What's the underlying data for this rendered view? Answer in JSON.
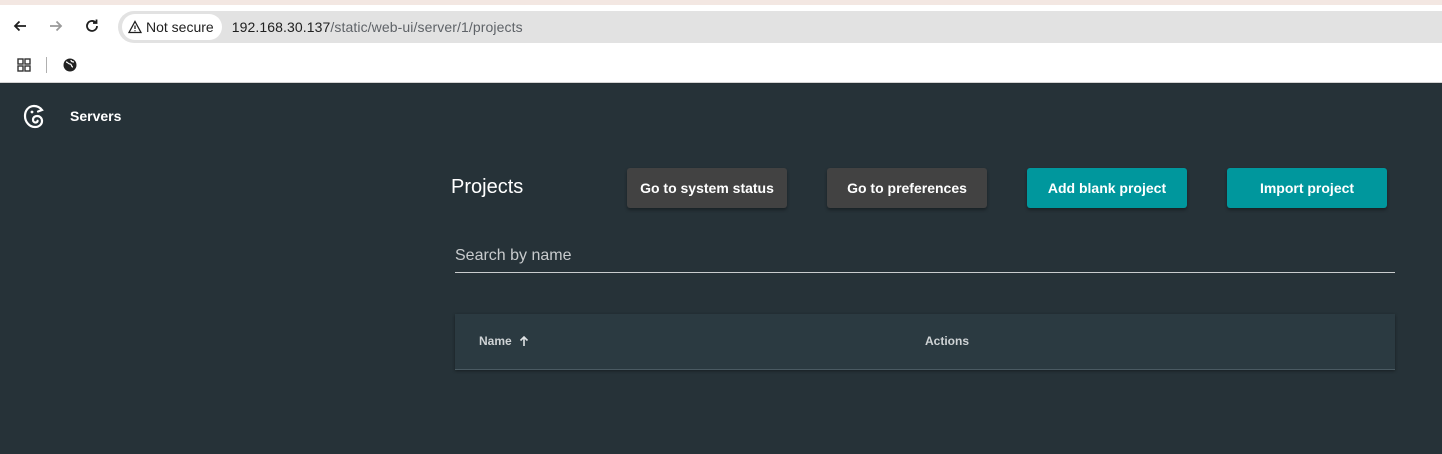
{
  "browser": {
    "security_label": "Not secure",
    "url_host": "192.168.30.137",
    "url_path": "/static/web-ui/server/1/projects"
  },
  "app": {
    "title": "Servers",
    "logo_icon": "chameleon-logo"
  },
  "page": {
    "title": "Projects",
    "buttons": {
      "system_status": "Go to system status",
      "preferences": "Go to preferences",
      "add_blank": "Add blank project",
      "import": "Import project"
    },
    "search": {
      "placeholder": "Search by name",
      "value": ""
    },
    "table": {
      "columns": [
        "Name",
        "Actions"
      ],
      "sort_column": "Name",
      "sort_direction": "ascending",
      "rows": []
    }
  },
  "colors": {
    "background": "#263238",
    "accent": "#00979d",
    "secondary_button": "#424242"
  }
}
